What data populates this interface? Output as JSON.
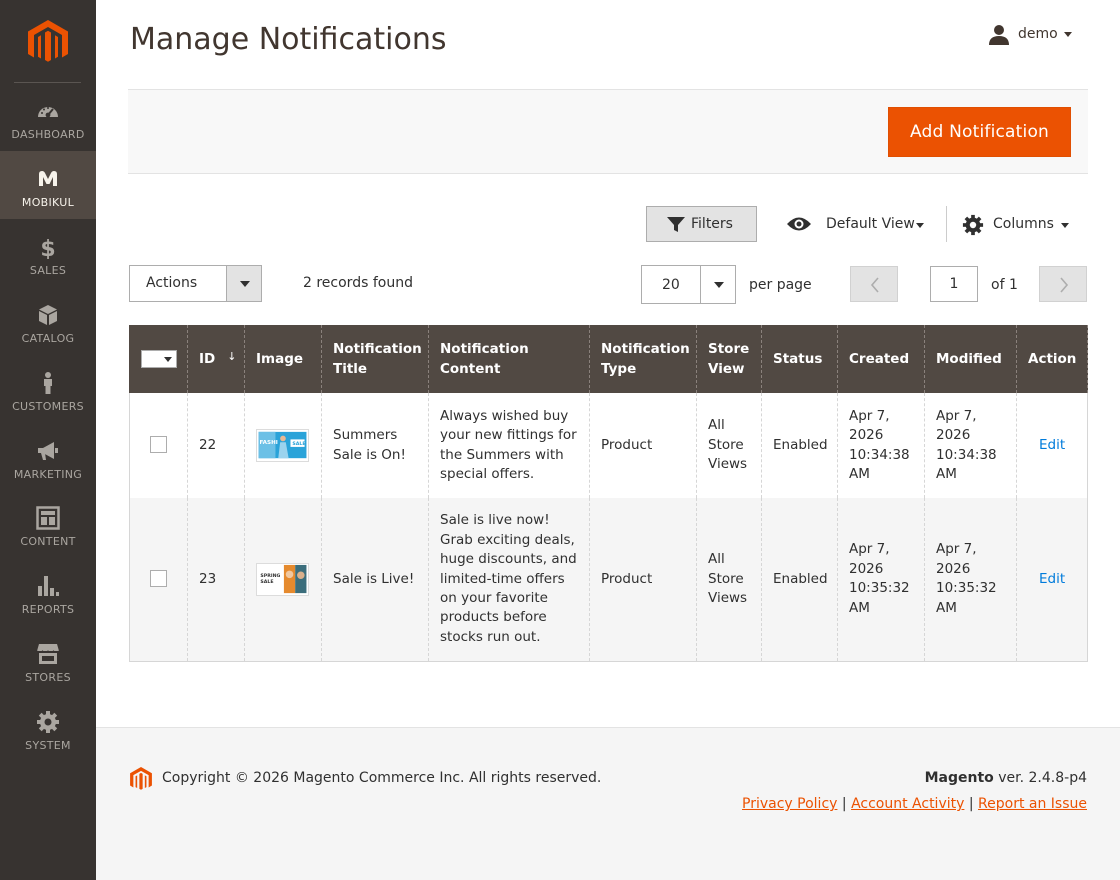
{
  "sidebar": {
    "items": [
      {
        "label": "DASHBOARD",
        "icon": "dashboard-icon"
      },
      {
        "label": "MOBIKUL",
        "icon": "mobikul-icon",
        "active": true
      },
      {
        "label": "SALES",
        "icon": "dollar-icon"
      },
      {
        "label": "CATALOG",
        "icon": "box-icon"
      },
      {
        "label": "CUSTOMERS",
        "icon": "person-icon"
      },
      {
        "label": "MARKETING",
        "icon": "megaphone-icon"
      },
      {
        "label": "CONTENT",
        "icon": "layout-icon"
      },
      {
        "label": "REPORTS",
        "icon": "bar-chart-icon"
      },
      {
        "label": "STORES",
        "icon": "storefront-icon"
      },
      {
        "label": "SYSTEM",
        "icon": "gear-icon"
      }
    ]
  },
  "header": {
    "title": "Manage Notifications",
    "user": "demo"
  },
  "action_bar": {
    "add_label": "Add Notification"
  },
  "toolbar": {
    "filters_label": "Filters",
    "default_view_label": "Default View",
    "columns_label": "Columns",
    "actions_label": "Actions",
    "records_found": "2 records found",
    "per_page_value": "20",
    "per_page_label": "per page",
    "current_page": "1",
    "page_of": "of 1"
  },
  "grid": {
    "columns": [
      "ID",
      "Image",
      "Notification Title",
      "Notification Content",
      "Notification Type",
      "Store View",
      "Status",
      "Created",
      "Modified",
      "Action"
    ],
    "sort_arrow": "↓",
    "rows": [
      {
        "id": "22",
        "image": "fashion-sale-thumbnail",
        "title": "Summers Sale is On!",
        "content": "Always wished buy your new fittings for the Summers with special offers.",
        "type": "Product",
        "store_view": "All Store Views",
        "status": "Enabled",
        "created": "Apr 7, 2026 10:34:38 AM",
        "modified": "Apr 7, 2026 10:34:38 AM",
        "action": "Edit"
      },
      {
        "id": "23",
        "image": "spring-sale-thumbnail",
        "title": "Sale is Live!",
        "content": "Sale is live now! Grab exciting deals, huge discounts, and limited-time offers on your favorite products before stocks run out.",
        "type": "Product",
        "store_view": "All Store Views",
        "status": "Enabled",
        "created": "Apr 7, 2026 10:35:32 AM",
        "modified": "Apr 7, 2026 10:35:32 AM",
        "action": "Edit"
      }
    ]
  },
  "footer": {
    "copyright": "Copyright © 2026 Magento Commerce Inc. All rights reserved.",
    "brand": "Magento",
    "version": "ver. 2.4.8-p4",
    "links": [
      "Privacy Policy",
      "Account Activity",
      "Report an Issue"
    ],
    "separator": "|"
  },
  "colors": {
    "sidebar_bg": "#373330",
    "sidebar_active": "#514943",
    "accent": "#eb5202",
    "grid_header": "#514943",
    "link": "#007bdb"
  }
}
